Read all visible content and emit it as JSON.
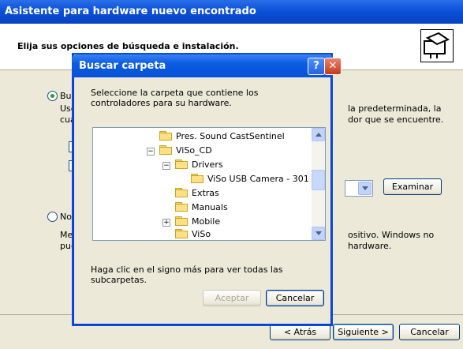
{
  "wizard": {
    "title": "Asistente para hardware nuevo encontrado",
    "heading": "Elija sus opciones de búsqueda e instalación.",
    "option1_label": "Bus",
    "option1_desc_line1": "Use",
    "option1_desc_line2": "cua",
    "option1_desc_right1": "la predeterminada, la",
    "option1_desc_right2": "dor que se encuentre.",
    "option2_label": "No",
    "option2_desc_line1": "Mec",
    "option2_desc_line2": "pue",
    "option2_desc_right1": "ositivo. Windows no",
    "option2_desc_right2": "hardware.",
    "browse_button": "Examinar",
    "back_button": "< Atrás",
    "next_button": "Siguiente >",
    "cancel_button": "Cancelar"
  },
  "dialog": {
    "title": "Buscar carpeta",
    "help_glyph": "?",
    "close_glyph": "✕",
    "description": "Seleccione la carpeta que contiene los controladores para su hardware.",
    "tree": [
      {
        "label": "Pres. Sound CastSentinel",
        "expander": ""
      },
      {
        "label": "ViSo_CD",
        "expander": "−"
      },
      {
        "label": "Drivers",
        "expander": "−"
      },
      {
        "label": "ViSo USB Camera - 301",
        "expander": ""
      },
      {
        "label": "Extras",
        "expander": ""
      },
      {
        "label": "Manuals",
        "expander": ""
      },
      {
        "label": "Mobile",
        "expander": "+"
      },
      {
        "label": "ViSo",
        "expander": ""
      }
    ],
    "hint": "Haga clic en el signo más para ver todas las subcarpetas.",
    "ok_button": "Aceptar",
    "cancel_button": "Cancelar"
  },
  "colors": {
    "title_blue": "#0a4fd8",
    "window_face": "#ece9d8"
  }
}
